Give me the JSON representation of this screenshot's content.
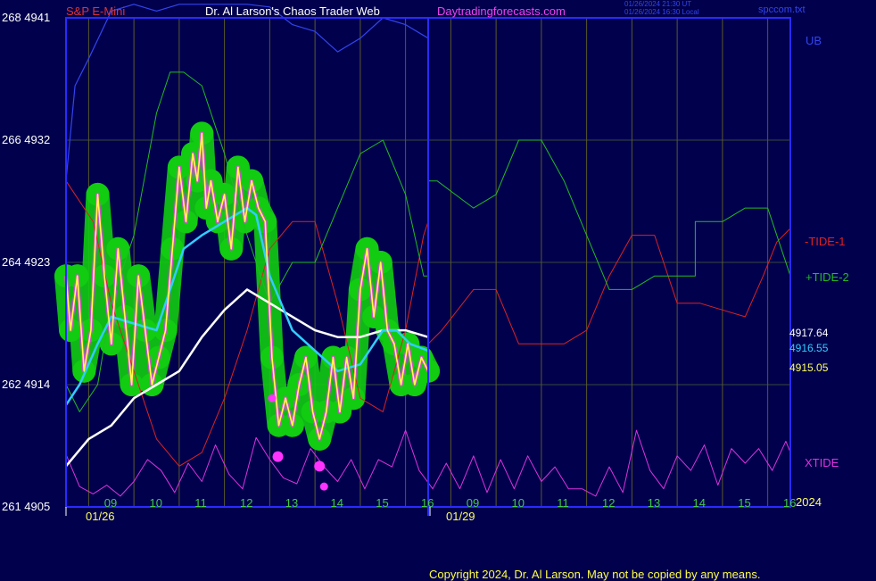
{
  "header": {
    "instrument": "S&P E-Mini",
    "site_title": "Dr. Al Larson's Chaos Trader Web",
    "site_url": "Daytradingforecasts.com",
    "stamp_utc": "01/26/2024 21:30 UT",
    "stamp_local": "01/26/2024 16:30 Local",
    "source_file": "spccom.txt"
  },
  "footer": {
    "copyright": "Copyright 2024, Dr. Al Larson. May not be copied by any means."
  },
  "colors": {
    "background": "#00004d",
    "frame": "#2a2aff",
    "grid": "#3a4a3a",
    "hour_grid": "#5a5a2a",
    "price_yellow": "#ffff44",
    "price_glow": "#11cc11",
    "cyan_avg": "#33ccff",
    "white_avg": "#ffffff",
    "ub": "#3344ee",
    "tide1": "#dd2222",
    "tide2": "#22bb22",
    "xtide": "#dd33dd",
    "marker": "#ff33ff",
    "hour_label": "#44cc44",
    "axis_text": "#ffffff",
    "date_text": "#ffff66"
  },
  "chart_data": {
    "type": "line",
    "title": "S&P E-Mini",
    "y_axis": {
      "ticks": [
        {
          "level": "268",
          "price": 4941
        },
        {
          "level": "266",
          "price": 4932
        },
        {
          "level": "264",
          "price": 4923
        },
        {
          "level": "262",
          "price": 4914
        },
        {
          "level": "261",
          "price": 4905
        }
      ],
      "range": [
        4905,
        4941
      ]
    },
    "x_axis": {
      "hour_labels": [
        "09",
        "10",
        "11",
        "12",
        "13",
        "14",
        "15",
        "16",
        "09",
        "10",
        "11",
        "12",
        "13",
        "14",
        "15",
        "16"
      ],
      "date_labels": [
        "01/26",
        "01/29"
      ],
      "year_label": "2024",
      "hours_per_session": 8
    },
    "readouts": [
      {
        "value": "4917.64",
        "series": "white-average"
      },
      {
        "value": "4916.55",
        "series": "cyan-average"
      },
      {
        "value": "4915.05",
        "series": "price"
      }
    ],
    "series_labels": {
      "ub": "UB",
      "tide1": "-TIDE-1",
      "tide2": "+TIDE-2",
      "xtide": "XTIDE"
    },
    "series": [
      {
        "id": "ub",
        "unit": "price",
        "x": [
          8.0,
          8.2,
          8.5,
          9.0,
          9.5,
          10.0,
          10.5,
          11.0,
          11.5,
          12.0,
          12.5,
          13.0,
          13.5,
          14.0,
          14.5,
          15.0,
          15.5,
          16.0
        ],
        "y": [
          4929,
          4936,
          4938,
          4941.5,
          4942,
          4941.5,
          4942,
          4942,
          4942,
          4942,
          4941.8,
          4940.5,
          4940,
          4938.5,
          4939.5,
          4941,
          4940.5,
          4939.5
        ]
      },
      {
        "id": "tide1",
        "unit": "price",
        "x": [
          8.0,
          8.6,
          9.0,
          9.5,
          10.0,
          10.5,
          11.0,
          11.5,
          12.0,
          12.5,
          13.0,
          13.5,
          14.0,
          14.5,
          15.0,
          15.5,
          15.9,
          16.0,
          16.0,
          16.3,
          17.0,
          17.5,
          18.0,
          18.5,
          19.0,
          19.5,
          20.0,
          20.5,
          21.0,
          21.5,
          22.0,
          22.5,
          23.0,
          23.4,
          23.7,
          24.0
        ],
        "y": [
          4929,
          4926,
          4920,
          4915,
          4910,
          4908,
          4909,
          4913,
          4918,
          4924,
          4926,
          4926,
          4920,
          4913,
          4912,
          4918,
          4925,
          4926,
          4917,
          4918,
          4921,
          4921,
          4917,
          4917,
          4917,
          4918,
          4922,
          4925,
          4925,
          4920,
          4920,
          4919.5,
          4919,
          4922,
          4924.5,
          4925.5
        ]
      },
      {
        "id": "tide2",
        "unit": "price",
        "x": [
          8.0,
          8.3,
          8.7,
          9.0,
          9.5,
          10.0,
          10.3,
          10.6,
          11.0,
          11.5,
          12.0,
          12.5,
          13.0,
          13.5,
          14.0,
          14.5,
          15.0,
          15.5,
          15.9,
          16.0,
          16.0,
          16.2,
          17.0,
          17.5,
          18.0,
          18.5,
          19.0,
          19.5,
          20.0,
          20.5,
          21.0,
          21.5,
          21.9,
          21.9,
          22.5,
          23.0,
          23.5,
          24.0
        ],
        "y": [
          4914,
          4912,
          4914,
          4920,
          4925,
          4934,
          4937,
          4937,
          4936,
          4931,
          4925,
          4920,
          4923,
          4923,
          4927,
          4931,
          4932,
          4928,
          4922,
          4922,
          4929,
          4929,
          4927,
          4928,
          4932,
          4932,
          4929,
          4925,
          4921,
          4921,
          4922,
          4922,
          4922,
          4926,
          4926,
          4927,
          4927,
          4922
        ]
      },
      {
        "id": "xtide",
        "unit": "osc",
        "range": [
          0,
          100
        ],
        "x": [
          8.0,
          8.3,
          8.6,
          8.9,
          9.2,
          9.5,
          9.8,
          10.1,
          10.4,
          10.7,
          11.0,
          11.3,
          11.6,
          11.9,
          12.2,
          12.5,
          12.8,
          13.1,
          13.4,
          13.7,
          14.0,
          14.3,
          14.6,
          14.9,
          15.2,
          15.5,
          15.8,
          16.1,
          16.4,
          16.7,
          17.0,
          17.3,
          17.6,
          17.9,
          18.2,
          18.5,
          18.8,
          19.1,
          19.4,
          19.7,
          20.0,
          20.3,
          20.6,
          20.9,
          21.2,
          21.5,
          21.8,
          22.1,
          22.4,
          22.7,
          23.0,
          23.3,
          23.6,
          23.9,
          24.0
        ],
        "y": [
          62,
          18,
          8,
          20,
          5,
          25,
          55,
          40,
          10,
          50,
          25,
          75,
          35,
          15,
          85,
          55,
          30,
          22,
          70,
          45,
          25,
          55,
          15,
          55,
          45,
          95,
          40,
          15,
          50,
          15,
          60,
          10,
          55,
          15,
          60,
          25,
          45,
          15,
          15,
          5,
          45,
          10,
          95,
          40,
          15,
          60,
          40,
          75,
          20,
          70,
          50,
          70,
          40,
          80,
          65
        ]
      },
      {
        "id": "price",
        "unit": "price",
        "x": [
          8.0,
          8.1,
          8.25,
          8.4,
          8.55,
          8.7,
          8.85,
          9.0,
          9.15,
          9.3,
          9.45,
          9.6,
          9.75,
          9.9,
          10.05,
          10.2,
          10.35,
          10.5,
          10.65,
          10.8,
          10.9,
          11.0,
          11.1,
          11.2,
          11.35,
          11.5,
          11.65,
          11.8,
          11.95,
          12.1,
          12.25,
          12.4,
          12.55,
          12.7,
          12.85,
          13.0,
          13.15,
          13.3,
          13.45,
          13.6,
          13.75,
          13.9,
          14.05,
          14.2,
          14.35,
          14.5,
          14.65,
          14.8,
          14.95,
          15.1,
          15.25,
          15.4,
          15.55,
          15.7,
          15.85,
          16.0
        ],
        "y": [
          4922,
          4918,
          4922,
          4915,
          4918,
          4928,
          4922,
          4917,
          4924,
          4919,
          4914,
          4922,
          4918,
          4914,
          4916,
          4918,
          4924,
          4930,
          4926,
          4931,
          4929,
          4932.5,
          4927,
          4929,
          4926,
          4928,
          4924,
          4930,
          4926,
          4929,
          4927,
          4926,
          4916,
          4911,
          4913,
          4911,
          4914,
          4916,
          4912,
          4910,
          4912,
          4916,
          4912,
          4916,
          4913,
          4921,
          4924,
          4919,
          4923,
          4918,
          4917,
          4914,
          4917,
          4914,
          4916,
          4915
        ]
      },
      {
        "id": "cyan-avg",
        "unit": "price",
        "x": [
          8.0,
          8.3,
          8.7,
          9.0,
          9.5,
          10.0,
          10.3,
          10.6,
          11.0,
          11.5,
          12.0,
          12.2,
          12.5,
          13.0,
          13.5,
          14.0,
          14.5,
          15.0,
          15.3,
          15.6,
          16.0
        ],
        "y": [
          4912.5,
          4914,
          4917,
          4919,
          4918.5,
          4918,
          4921,
          4924,
          4925,
          4926,
          4927,
          4926.5,
          4922,
          4918,
          4916.5,
          4915,
          4915.5,
          4918,
          4918,
          4917,
          4916.5
        ]
      },
      {
        "id": "white-avg",
        "unit": "price",
        "x": [
          8.0,
          8.5,
          9.0,
          9.5,
          10.0,
          10.5,
          11.0,
          11.5,
          12.0,
          12.5,
          13.0,
          13.5,
          14.0,
          14.5,
          15.0,
          15.5,
          16.0
        ],
        "y": [
          4908,
          4910,
          4911,
          4913,
          4914,
          4915,
          4917.5,
          4919.5,
          4921,
          4920,
          4919,
          4918,
          4917.5,
          4917.5,
          4918,
          4918,
          4917.5
        ]
      }
    ],
    "markers": [
      {
        "x": 12.55,
        "y": 4913,
        "size": "small"
      },
      {
        "x": 12.68,
        "y": 4908.7,
        "size": "large"
      },
      {
        "x": 13.6,
        "y": 4908,
        "size": "large"
      },
      {
        "x": 13.7,
        "y": 4906.5,
        "size": "small"
      }
    ]
  }
}
